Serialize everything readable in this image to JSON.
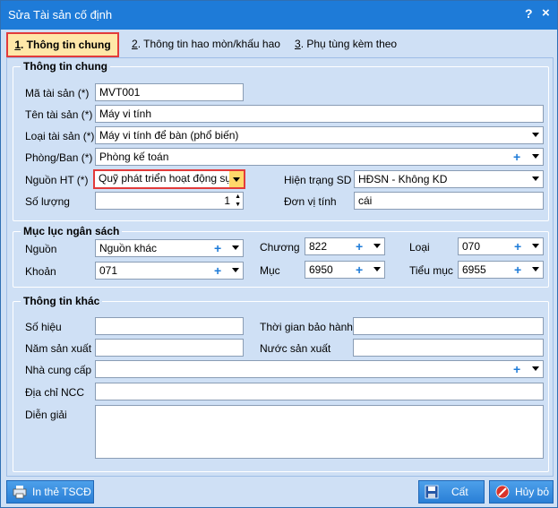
{
  "window": {
    "title": "Sửa Tài sản cố định",
    "help": "?",
    "close": "×"
  },
  "tabs": [
    {
      "num": "1",
      "label": ". Thông tin chung"
    },
    {
      "num": "2",
      "label": ". Thông tin hao mòn/khấu hao"
    },
    {
      "num": "3",
      "label": ". Phụ tùng kèm theo"
    }
  ],
  "general": {
    "legend": "Thông tin chung",
    "ma_label": "Mã tài sản (*)",
    "ma_value": "MVT001",
    "ten_label": "Tên tài sản (*)",
    "ten_value": "Máy vi tính",
    "loai_label": "Loại tài sản (*)",
    "loai_value": "Máy vi tính để bàn (phổ biến)",
    "phong_label": "Phòng/Ban (*)",
    "phong_value": "Phòng kế toán",
    "nguon_label": "Nguồn HT (*)",
    "nguon_value": "Quỹ phát triển hoạt động sự",
    "hientrang_label": "Hiện trạng SD",
    "hientrang_value": "HĐSN - Không KD",
    "soluong_label": "Số lượng",
    "soluong_value": "1",
    "donvi_label": "Đơn vị tính",
    "donvi_value": "cái"
  },
  "budget": {
    "legend": "Mục lục ngân sách",
    "nguon_label": "Nguồn",
    "nguon_value": "Nguồn khác",
    "chuong_label": "Chương",
    "chuong_value": "822",
    "loai_label": "Loại",
    "loai_value": "070",
    "khoan_label": "Khoản",
    "khoan_value": "071",
    "muc_label": "Mục",
    "muc_value": "6950",
    "tieumuc_label": "Tiểu mục",
    "tieumuc_value": "6955"
  },
  "other": {
    "legend": "Thông tin khác",
    "sohieu_label": "Số hiệu",
    "baohanh_label": "Thời gian bảo hành",
    "namsx_label": "Năm sản xuất",
    "nuocsx_label": "Nước sản xuất",
    "ncc_label": "Nhà cung cấp",
    "diachi_label": "Địa chỉ NCC",
    "diengiai_label": "Diễn giải"
  },
  "footer": {
    "print_label": "In thẻ TSCĐ",
    "save_label": "Cất",
    "cancel_label": "Hủy bỏ"
  },
  "colors": {
    "title_bar": "#1e7bd8",
    "highlight": "#e23b3b",
    "accent_plus": "#1e7bd8"
  }
}
